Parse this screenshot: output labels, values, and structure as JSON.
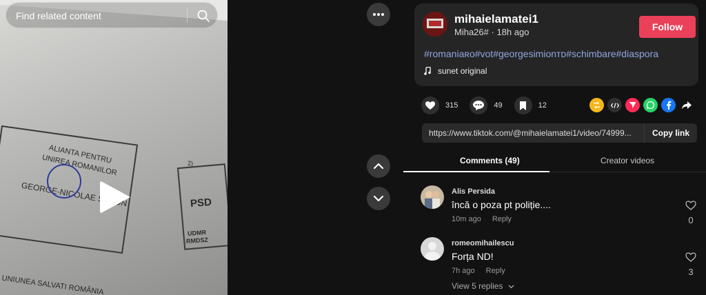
{
  "search": {
    "placeholder": "Find related content"
  },
  "video": {
    "ballot_texts": [
      "ALIANTA PENTRU",
      "UNIREA ROMANILOR",
      "GEORGE-NICOLAE SIMION",
      "PSD",
      "UDMR",
      "RMDSZ",
      "UNIUNEA SALVATI ROMÂNIA",
      "2)"
    ]
  },
  "post": {
    "username": "mihaielamatei1",
    "nickname": "Miha26#",
    "time": "18h ago",
    "follow_label": "Follow",
    "hashtags": "#romaniaʀᴏ#vot#georgesimionᴛᴅ#schimbare#diaspora",
    "sound": "sunet original"
  },
  "stats": {
    "likes": "315",
    "comments": "49",
    "saves": "12"
  },
  "share_icons": [
    "repost-icon",
    "embed-icon",
    "send-icon",
    "whatsapp-icon",
    "facebook-icon",
    "share-arrow-icon"
  ],
  "link": {
    "url": "https://www.tiktok.com/@mihaielamatei1/video/74999...",
    "copy_label": "Copy link"
  },
  "tabs": {
    "comments": "Comments (49)",
    "creator": "Creator videos"
  },
  "comments": [
    {
      "name": "Alis Persida",
      "text": "încă o poza pt poliție....",
      "time": "10m ago",
      "reply": "Reply",
      "likes": "0"
    },
    {
      "name": "romeomihailescu",
      "text": "Forța ND!",
      "time": "7h ago",
      "reply": "Reply",
      "likes": "3"
    }
  ],
  "view_replies": "View 5 replies",
  "colors": {
    "accent": "#ea4059",
    "hashtag": "#8fa6e0",
    "background": "#121212"
  }
}
